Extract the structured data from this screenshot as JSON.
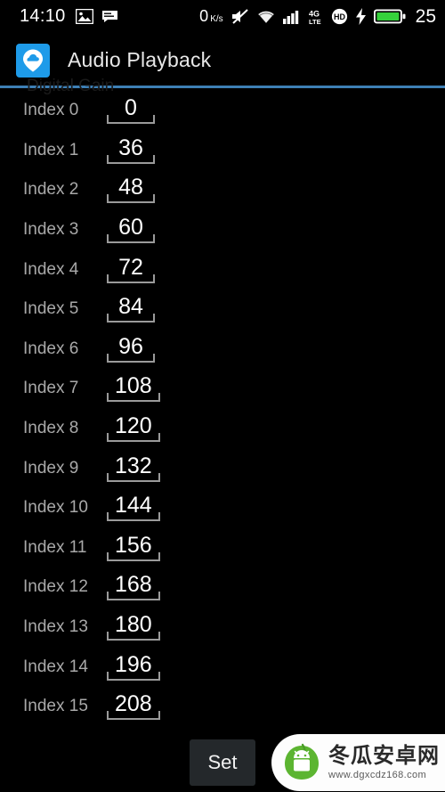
{
  "status_bar": {
    "clock": "14:10",
    "left_icons": [
      "image-icon",
      "message-icon"
    ],
    "data_speed": "0",
    "data_speed_unit": "K/s",
    "icons": [
      "mute-icon",
      "wifi-icon",
      "signal-bars-icon",
      "4g-lte-icon",
      "hd-icon",
      "charging-bolt-icon",
      "battery-icon"
    ],
    "network_type_top": "4G",
    "network_type_bottom": "LTE",
    "hd_label": "HD",
    "battery_percent": "25",
    "battery_color": "#35d13b"
  },
  "toolbar": {
    "app_icon": "cloud-pin-icon",
    "title": "Audio Playback",
    "accent_color": "#1E9BE9",
    "divider_color": "#3d7fb5"
  },
  "ghost_header": "Digital Gain",
  "list": {
    "rows": [
      {
        "label": "Index 0",
        "value": "0"
      },
      {
        "label": "Index 1",
        "value": "36"
      },
      {
        "label": "Index 2",
        "value": "48"
      },
      {
        "label": "Index 3",
        "value": "60"
      },
      {
        "label": "Index 4",
        "value": "72"
      },
      {
        "label": "Index 5",
        "value": "84"
      },
      {
        "label": "Index 6",
        "value": "96"
      },
      {
        "label": "Index 7",
        "value": "108"
      },
      {
        "label": "Index 8",
        "value": "120"
      },
      {
        "label": "Index 9",
        "value": "132"
      },
      {
        "label": "Index 10",
        "value": "144"
      },
      {
        "label": "Index 11",
        "value": "156"
      },
      {
        "label": "Index 12",
        "value": "168"
      },
      {
        "label": "Index 13",
        "value": "180"
      },
      {
        "label": "Index 14",
        "value": "196"
      },
      {
        "label": "Index 15",
        "value": "208"
      }
    ]
  },
  "bottom": {
    "set_label": "Set"
  },
  "watermark": {
    "logo": "winter-melon-android-logo",
    "site_name": "冬瓜安卓网",
    "url": "www.dgxcdz168.com",
    "logo_color": "#5cb531"
  }
}
